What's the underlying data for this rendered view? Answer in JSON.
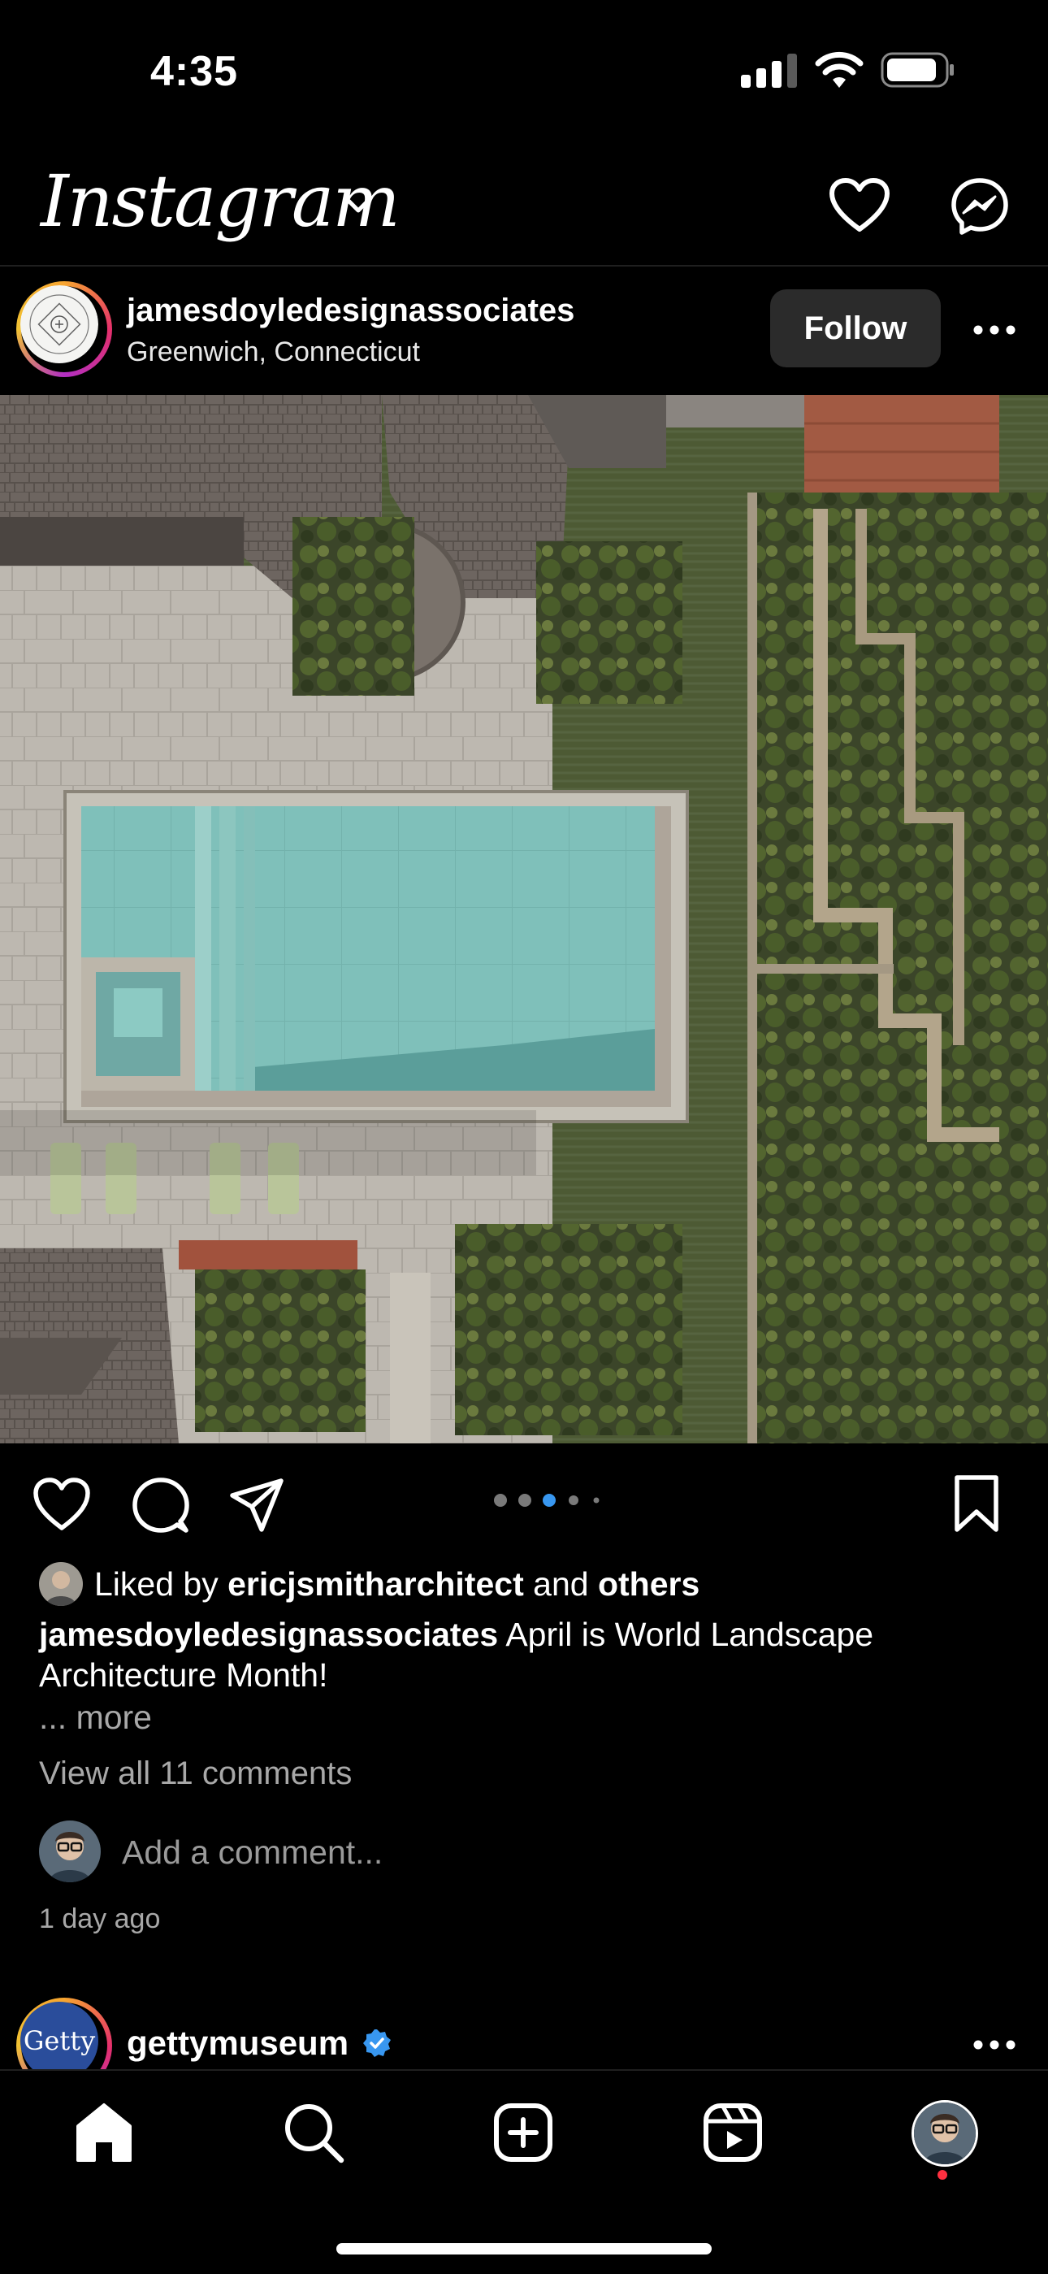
{
  "status_bar": {
    "time": "4:35"
  },
  "header": {
    "logo": "Instagram"
  },
  "post": {
    "username": "jamesdoyledesignassociates",
    "location": "Greenwich, Connecticut",
    "follow_label": "Follow",
    "carousel": {
      "total": 5,
      "active_index": 2
    },
    "likes": {
      "prefix": "Liked by",
      "user": "ericjsmitharchitect",
      "conj": "and",
      "others": "others"
    },
    "caption": {
      "author": "jamesdoyledesignassociates",
      "text": "April is World Landscape Architecture Month!"
    },
    "more_label": "... more",
    "view_comments": "View all 11 comments",
    "comment_placeholder": "Add a comment...",
    "time_ago": "1 day ago"
  },
  "next_post": {
    "username": "gettymuseum",
    "avatar_text": "Getty"
  },
  "colors": {
    "accent": "#3897f0",
    "notification": "#ff3040",
    "follow_bg": "#2b2b2b"
  },
  "tabs": [
    "home-icon",
    "search-icon",
    "create-icon",
    "reels-icon",
    "profile-icon"
  ]
}
